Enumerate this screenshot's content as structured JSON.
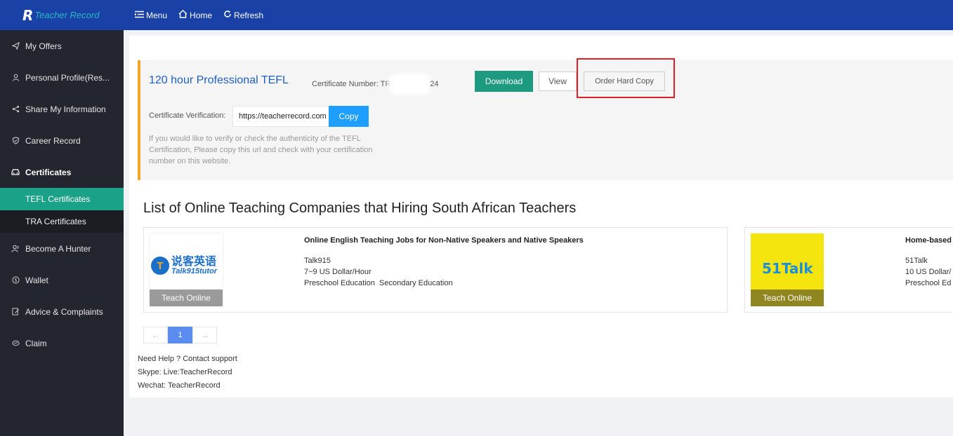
{
  "app": {
    "logo_mark": "R",
    "title": "Teacher Record"
  },
  "header": {
    "menu": "Menu",
    "home": "Home",
    "refresh": "Refresh"
  },
  "sidebar": {
    "items": [
      {
        "label": "My Offers",
        "icon": "send-icon"
      },
      {
        "label": "Personal Profile(Res...",
        "icon": "user-icon"
      },
      {
        "label": "Share My Information",
        "icon": "share-icon"
      },
      {
        "label": "Career Record",
        "icon": "shield-icon"
      },
      {
        "label": "Certificates",
        "icon": "car-icon"
      },
      {
        "label": "Become A Hunter",
        "icon": "users-icon"
      },
      {
        "label": "Wallet",
        "icon": "dollar-icon"
      },
      {
        "label": "Advice & Complaints",
        "icon": "edit-icon"
      },
      {
        "label": "Claim",
        "icon": "tag-icon"
      }
    ],
    "sub_items": [
      {
        "label": "TEFL Certificates",
        "active": true
      },
      {
        "label": "TRA Certificates",
        "active": false
      }
    ]
  },
  "certificate": {
    "title": "120 hour Professional TEFL",
    "number_label": "Certificate Number:",
    "number_prefix": "TR",
    "number_suffix": "24",
    "download": "Download",
    "view": "View",
    "order_hard_copy": "Order Hard Copy",
    "verification_label": "Certificate Verification:",
    "verification_url": "https://teacherrecord.com",
    "copy": "Copy",
    "help_text": "If you would like to verify or check the authenticity of the TEFL Certification, Please copy this url and check with your certification number on this website."
  },
  "companies_title": "List of Online Teaching Companies that Hiring South African Teachers",
  "companies": [
    {
      "heading": "Online English Teaching Jobs for Non-Native Speakers and Native Speakers",
      "name": "Talk915",
      "salary": "7~9 US Dollar/Hour",
      "education": "Preschool Education  Secondary Education",
      "badge": "Teach Online",
      "logo_cn": "说客英语",
      "logo_en": "Talk915tutor"
    },
    {
      "heading": "Home-based",
      "name": "51Talk",
      "salary": "10 US Dollar/",
      "education": "Preschool Ed",
      "badge": "Teach Online",
      "logo_text": "51Talk"
    }
  ],
  "pagination": {
    "prev": "←",
    "current": "1",
    "next": "→"
  },
  "support": {
    "line1": "Need Help ? Contact support",
    "line2": "Skype: Live:TeacherRecord",
    "line3": "Wechat: TeacherRecord"
  },
  "colors": {
    "header_blue": "#1a41a6",
    "sidebar_dark": "#23262e",
    "active_green": "#1aa187",
    "download_green": "#1d9a80",
    "copy_blue": "#1e9fff",
    "accent_orange": "#f3a629",
    "highlight_red": "#e21e26"
  }
}
